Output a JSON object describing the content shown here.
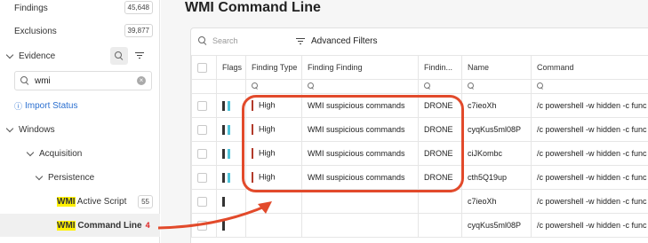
{
  "sidebar": {
    "findings": {
      "label": "Findings",
      "count": "45,648"
    },
    "exclusions": {
      "label": "Exclusions",
      "count": "39,877"
    },
    "evidence": {
      "label": "Evidence"
    },
    "search": {
      "value": "wmi"
    },
    "import_status": "Import Status",
    "windows": "Windows",
    "acquisition": "Acquisition",
    "persistence": "Persistence",
    "wmi_active_script": {
      "highlight": "WMI",
      "rest": " Active Script",
      "count": "55"
    },
    "wmi_command_line": {
      "highlight": "WMI",
      "rest": " Command Line",
      "count": "4"
    }
  },
  "main": {
    "title": "WMI Command Line",
    "search_placeholder": "Search",
    "advanced_filters": "Advanced Filters",
    "columns": [
      "Flags",
      "Finding Type",
      "Finding Finding",
      "Findin...",
      "Name",
      "Command"
    ]
  },
  "rows": [
    {
      "finding_type": "High",
      "finding": "WMI suspicious commands",
      "source": "DRONE",
      "name": "c7ieoXh",
      "command": "/c powershell -w hidden -c func"
    },
    {
      "finding_type": "High",
      "finding": "WMI suspicious commands",
      "source": "DRONE",
      "name": "cyqKus5ml08P",
      "command": "/c powershell -w hidden -c func"
    },
    {
      "finding_type": "High",
      "finding": "WMI suspicious commands",
      "source": "DRONE",
      "name": "ciJKombc",
      "command": "/c powershell -w hidden -c func"
    },
    {
      "finding_type": "High",
      "finding": "WMI suspicious commands",
      "source": "DRONE",
      "name": "cth5Q19up",
      "command": "/c powershell -w hidden -c func"
    },
    {
      "finding_type": "",
      "finding": "",
      "source": "",
      "name": "c7ieoXh",
      "command": "/c powershell -w hidden -c func"
    },
    {
      "finding_type": "",
      "finding": "",
      "source": "",
      "name": "cyqKus5ml08P",
      "command": "/c powershell -w hidden -c func"
    }
  ],
  "colors": {
    "accent_red": "#e24a2b",
    "flag_teal": "#4fc3d9",
    "flag_dark": "#333333",
    "severity_high": "#b23a2a",
    "link_blue": "#2a6fd0"
  }
}
